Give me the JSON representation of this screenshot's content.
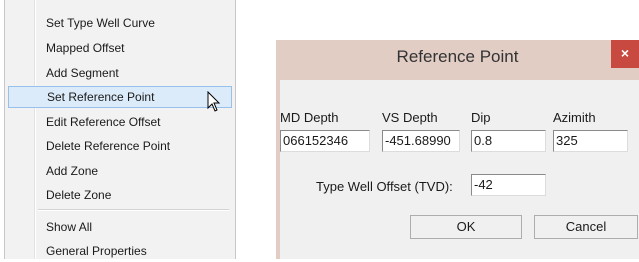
{
  "menu": {
    "items": [
      {
        "label": "Set Type Well Curve"
      },
      {
        "label": "Mapped Offset"
      },
      {
        "label": "Add Segment"
      },
      {
        "label": "Set Reference Point"
      },
      {
        "label": "Edit Reference Offset"
      },
      {
        "label": "Delete Reference Point"
      },
      {
        "label": "Add Zone"
      },
      {
        "label": "Delete Zone"
      },
      {
        "label": "Show All"
      },
      {
        "label": "General Properties"
      }
    ],
    "highlighted": "Set Reference Point"
  },
  "dialog": {
    "title": "Reference Point",
    "close_glyph": "×",
    "columns": {
      "md_depth": {
        "label": "MD Depth",
        "value": "066152346"
      },
      "vs_depth": {
        "label": "VS Depth",
        "value": "-451.68990"
      },
      "dip": {
        "label": "Dip",
        "value": "0.8"
      },
      "azimuth": {
        "label": "Azimith",
        "value": "325"
      }
    },
    "offset": {
      "label": "Type Well Offset (TVD):",
      "value": "-42"
    },
    "buttons": {
      "ok": "OK",
      "cancel": "Cancel"
    }
  },
  "colors": {
    "titlebar": "#e1cdc4",
    "close": "#c7493f",
    "menu_highlight": "#dcebfa"
  }
}
